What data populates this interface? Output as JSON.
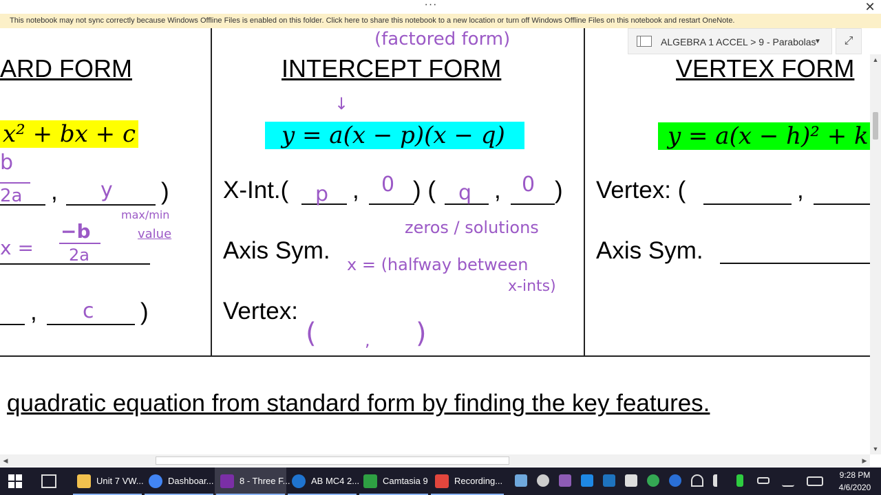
{
  "window": {
    "ellipsis": "···",
    "close": "✕"
  },
  "banner": {
    "text": "This notebook may not sync correctly because Windows Offline Files is enabled on this folder. Click here to share this notebook to a new location or turn off Windows Offline Files on this notebook and restart OneNote."
  },
  "breadcrumb": {
    "text": "ALGEBRA 1 ACCEL > 9 - Parabolas",
    "dropdown": "▼",
    "expand": "⤢"
  },
  "standard": {
    "heading": "ARD FORM",
    "equation": "x² + bx + c",
    "comma1": ",",
    "close1": ")",
    "comma2": ",",
    "close2": ")",
    "hw_b": "b",
    "hw_2a": "2a",
    "hw_y": "y",
    "hw_maxmin": "max/min",
    "hw_value": "value",
    "hw_xeq": "x =",
    "hw_negb": "−b",
    "hw_2a_b": "2a",
    "hw_c": "c"
  },
  "intercept": {
    "annotation": "(factored form)",
    "heading": "INTERCEPT FORM",
    "arrow": "↓",
    "equation": "y = a(x − p)(x − q)",
    "xint_label": "X-Int.(",
    "xint_comma1": ",",
    "xint_mid": ") (",
    "xint_comma2": ",",
    "xint_close": ")",
    "hw_p": "p",
    "hw_0a": "0",
    "hw_q": "q",
    "hw_0b": "0",
    "hw_zeros": "zeros / solutions",
    "axis_label": "Axis Sym.",
    "hw_axis1": "x =  (halfway between",
    "hw_axis2": "x-ints)",
    "vertex_label": "Vertex:",
    "hw_paren_open": "(",
    "hw_paren_comma": ",",
    "hw_paren_close": ")"
  },
  "vertex": {
    "heading": "VERTEX FORM",
    "equation": "y = a(x − h)² + k",
    "vertex_label": "Vertex: (",
    "vertex_comma": ",",
    "axis_label": "Axis Sym."
  },
  "bottom_text": "quadratic equation from standard form by finding the key features.",
  "colors": {
    "highlight_yellow": "#ffff00",
    "highlight_cyan": "#00ffff",
    "highlight_green": "#00ff00",
    "ink_purple": "#9b59c6",
    "banner_bg": "#fcf0c8"
  },
  "taskbar": {
    "items": [
      {
        "label": "Unit 7 VW...",
        "icon": "folder-icon",
        "color": "#f2c14e",
        "active": false
      },
      {
        "label": "Dashboar...",
        "icon": "chrome-icon",
        "color": "#4285f4",
        "active": false
      },
      {
        "label": "8 - Three F...",
        "icon": "onenote-icon",
        "color": "#7b2fa6",
        "active": true
      },
      {
        "label": "AB MC4 2...",
        "icon": "edge-icon",
        "color": "#1f74d0",
        "active": false
      },
      {
        "label": "Camtasia 9",
        "icon": "camtasia-icon",
        "color": "#2ea043",
        "active": false
      },
      {
        "label": "Recording...",
        "icon": "recording-icon",
        "color": "#e2463d",
        "active": false
      }
    ],
    "time": "9:28 PM",
    "date": "4/6/2020"
  }
}
